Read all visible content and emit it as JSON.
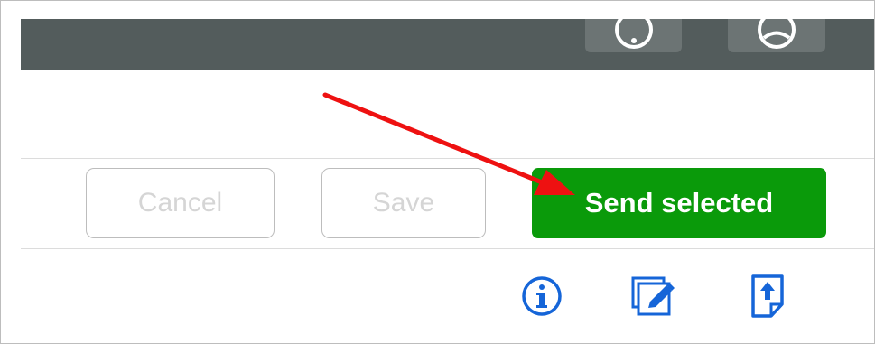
{
  "toolbar": {
    "cancel_label": "Cancel",
    "save_label": "Save",
    "send_label": "Send selected"
  },
  "topbar": {
    "icons": [
      "help-circle-icon",
      "user-circle-icon"
    ]
  },
  "row_actions": {
    "icons": [
      "info-icon",
      "edit-icon",
      "upload-document-icon"
    ]
  },
  "annotation": {
    "arrow_color": "#ee1111"
  },
  "colors": {
    "topbar": "#535c5c",
    "primary_green": "#0a9a0a",
    "icon_blue": "#1565d8"
  }
}
